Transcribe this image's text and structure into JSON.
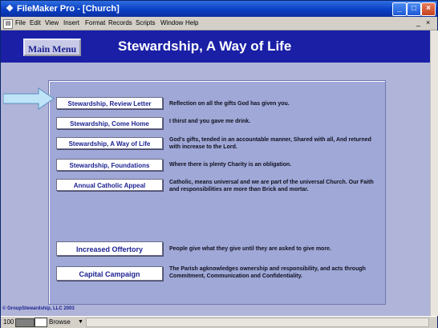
{
  "window": {
    "title": "FileMaker Pro - [Church]",
    "minimize_glyph": "_",
    "maximize_glyph": "□",
    "close_glyph": "×"
  },
  "menubar": {
    "items": [
      "File",
      "Edit",
      "View",
      "Insert",
      "Format",
      "Records",
      "Scripts",
      "Window",
      "Help"
    ],
    "mdi_minimize": "_",
    "mdi_close": "×"
  },
  "header": {
    "main_menu_label": "Main Menu",
    "title": "Stewardship, A Way of Life"
  },
  "rows": [
    {
      "button": "Stewardship, Review Letter",
      "description": "Reflection on all the gifts God has given you."
    },
    {
      "button": "Stewardship, Come Home",
      "description": "I thirst and you gave me drink."
    },
    {
      "button": "Stewardship, A Way of Life",
      "description": "God's gifts, tended in an accountable manner, Shared with all, And returned with increase to the Lord."
    },
    {
      "button": "Stewardship, Foundations",
      "description": "Where there is plenty Charity is an obligation."
    },
    {
      "button": "Annual Catholic Appeal",
      "description": "Catholic, means universal and we are part of the universal Church. Our Faith and responsibilities are more than Brick and mortar."
    },
    {
      "button": "Increased Offertory",
      "description": "People give what they give until they are asked to give more."
    },
    {
      "button": "Capital Campaign",
      "description": "The Parish agknowledges ownership and responsibility, and acts through Commitment, Communication and Confidentiality."
    }
  ],
  "copyright": "© GroupStewardship, LLC  2003",
  "statusbar": {
    "zoom": "100",
    "mode": "Browse"
  },
  "colors": {
    "header_bg": "#1a1fa6",
    "content_bg": "#afb4d8",
    "panel_bg": "#9fa8d6",
    "button_text": "#1a1f8f",
    "arrow_fill": "#bfe4f8"
  }
}
